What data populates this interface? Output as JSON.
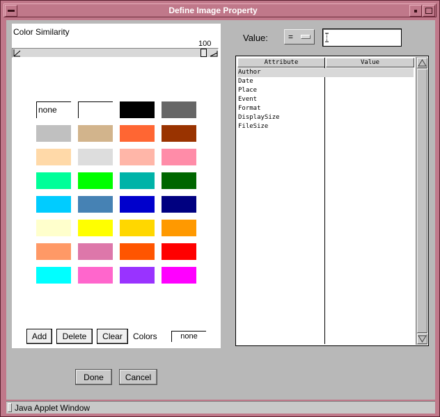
{
  "window": {
    "title": "Define Image Property"
  },
  "color_panel": {
    "similarity_label": "Color Similarity",
    "similarity_value": "100",
    "swatch_none_label": "none",
    "swatches": [
      "#ffffff",
      "#ffffff",
      "#000000",
      "#666666",
      "#c0c0c0",
      "#d2b48c",
      "#ff6633",
      "#993300",
      "#ffd9a8",
      "#dddddd",
      "#ffb6a8",
      "#ff8ca8",
      "#00ff99",
      "#00ff00",
      "#00b3a8",
      "#006600",
      "#00ccff",
      "#4682b4",
      "#0000cc",
      "#000080",
      "#ffffcc",
      "#ffff00",
      "#ffd700",
      "#ff9900",
      "#ff9966",
      "#dd77aa",
      "#ff5500",
      "#ff0000",
      "#00ffff",
      "#ff66cc",
      "#9933ff",
      "#ff00ff"
    ],
    "add_label": "Add",
    "delete_label": "Delete",
    "clear_label": "Clear",
    "colors_label": "Colors",
    "colors_value": "none"
  },
  "value_panel": {
    "value_label": "Value:",
    "operator": "=",
    "value_input": ""
  },
  "attribute_table": {
    "headers": [
      "Attribute",
      "Value"
    ],
    "rows": [
      {
        "attribute": "Author",
        "value": ""
      },
      {
        "attribute": "Date",
        "value": ""
      },
      {
        "attribute": "Place",
        "value": ""
      },
      {
        "attribute": "Event",
        "value": ""
      },
      {
        "attribute": "Format",
        "value": ""
      },
      {
        "attribute": "DisplaySize",
        "value": ""
      },
      {
        "attribute": "FileSize",
        "value": ""
      }
    ],
    "selected_row": 0
  },
  "actions": {
    "done_label": "Done",
    "cancel_label": "Cancel"
  },
  "status": {
    "text": "Java Applet Window"
  }
}
